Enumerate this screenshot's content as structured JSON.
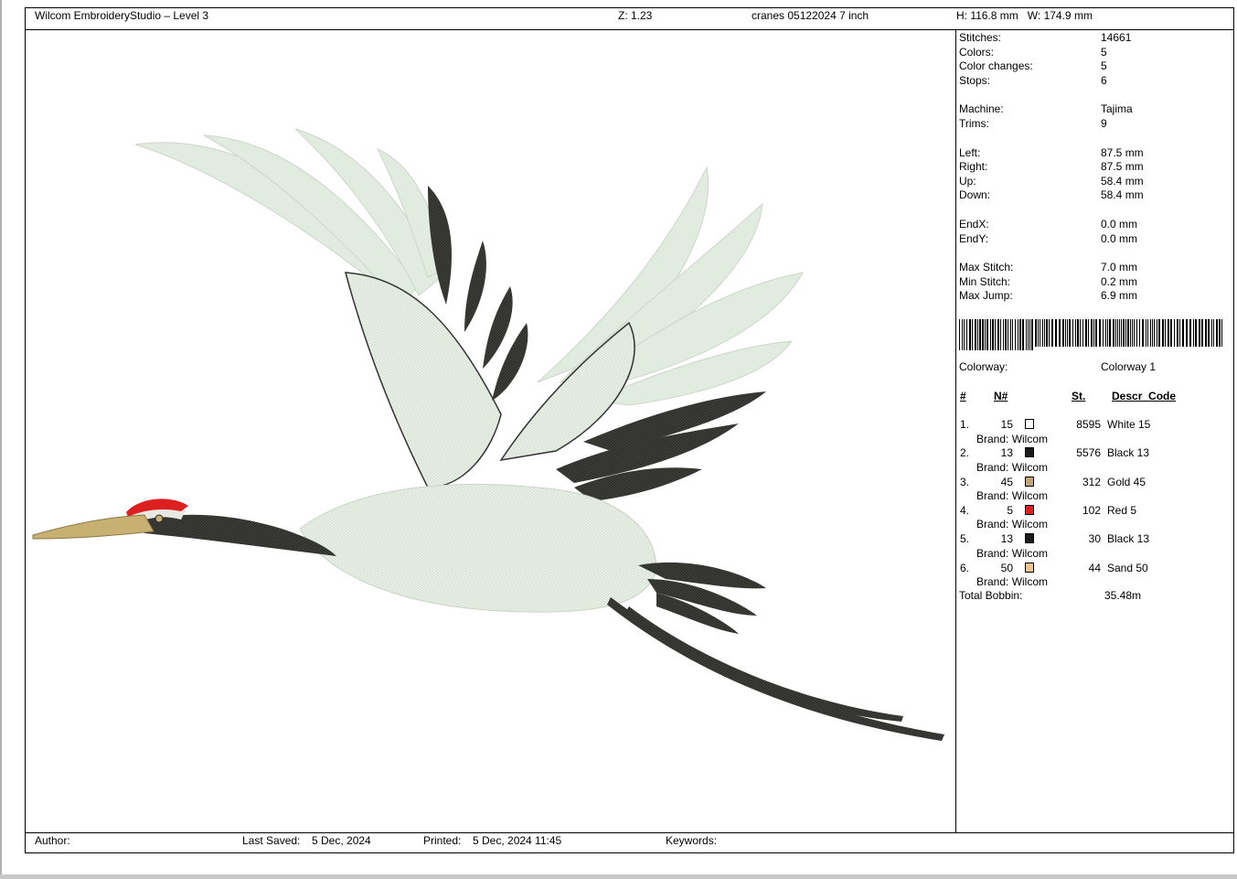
{
  "header": {
    "app_title": "Wilcom EmbroideryStudio – Level 3",
    "zoom": "Z: 1.23",
    "design_name": "cranes 05122024 7 inch",
    "dimensions": "H: 116.8 mm   W: 174.9 mm"
  },
  "stats": [
    {
      "label": "Stitches:",
      "value": "14661"
    },
    {
      "label": "Colors:",
      "value": "5"
    },
    {
      "label": "Color changes:",
      "value": "5"
    },
    {
      "label": "Stops:",
      "value": "6"
    },
    {
      "label": "Machine:",
      "value": "Tajima"
    },
    {
      "label": "Trims:",
      "value": "9"
    },
    {
      "label": "Left:",
      "value": "87.5 mm"
    },
    {
      "label": "Right:",
      "value": "87.5 mm"
    },
    {
      "label": "Up:",
      "value": "58.4 mm"
    },
    {
      "label": "Down:",
      "value": "58.4 mm"
    },
    {
      "label": "EndX:",
      "value": "0.0 mm"
    },
    {
      "label": "EndY:",
      "value": "0.0 mm"
    },
    {
      "label": "Max Stitch:",
      "value": "7.0 mm"
    },
    {
      "label": "Min Stitch:",
      "value": "0.2 mm"
    },
    {
      "label": "Max Jump:",
      "value": "6.9 mm"
    }
  ],
  "colorway": {
    "label": "Colorway:",
    "value": "Colorway 1"
  },
  "table": {
    "headers": {
      "num": "#",
      "n": "N#",
      "st": "St.",
      "descr": "Descr_Code"
    },
    "rows": [
      {
        "idx": "1.",
        "n": "15",
        "swatch": "#ffffff",
        "st": "8595",
        "descr": "White 15",
        "brand": "Brand: Wilcom"
      },
      {
        "idx": "2.",
        "n": "13",
        "swatch": "#1a1a1a",
        "st": "5576",
        "descr": "Black 13",
        "brand": "Brand: Wilcom"
      },
      {
        "idx": "3.",
        "n": "45",
        "swatch": "#c4a57a",
        "st": "312",
        "descr": "Gold 45",
        "brand": "Brand: Wilcom"
      },
      {
        "idx": "4.",
        "n": "5",
        "swatch": "#dc1f1f",
        "st": "102",
        "descr": "Red 5",
        "brand": "Brand: Wilcom"
      },
      {
        "idx": "5.",
        "n": "13",
        "swatch": "#1a1a1a",
        "st": "30",
        "descr": "Black 13",
        "brand": "Brand: Wilcom"
      },
      {
        "idx": "6.",
        "n": "50",
        "swatch": "#f2c58c",
        "st": "44",
        "descr": "Sand 50",
        "brand": "Brand: Wilcom"
      }
    ],
    "total_label": "Total Bobbin:",
    "total_value": "35.48m"
  },
  "footer": {
    "author_label": "Author:",
    "last_saved_label": "Last Saved:",
    "last_saved_value": "5 Dec, 2024",
    "printed_label": "Printed:",
    "printed_value": "5 Dec, 2024 11:45",
    "keywords_label": "Keywords:"
  },
  "colors": {
    "thread_white": "#e6eee4",
    "thread_black": "#2e2e2a",
    "thread_gold": "#c8b072",
    "thread_red": "#dc1f1f"
  }
}
